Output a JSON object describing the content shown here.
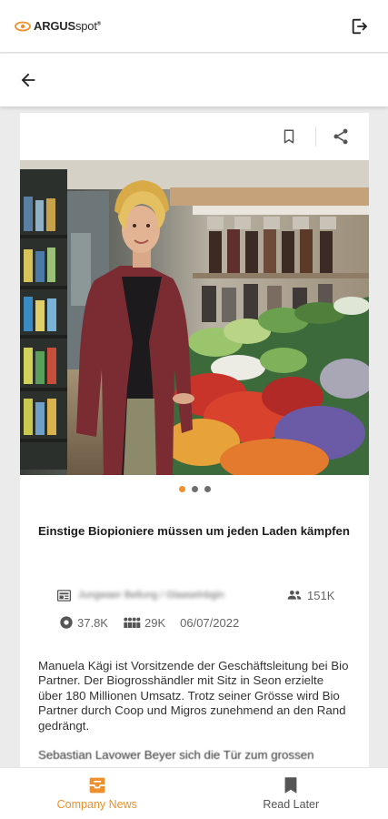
{
  "app": {
    "logo_brand": "ARGUS",
    "logo_suffix": "spot",
    "logo_mark": "®"
  },
  "icons": {
    "logout": "logout-icon",
    "back": "arrow-left-icon",
    "bookmark": "bookmark-outline-icon",
    "share": "share-icon",
    "newspaper": "newspaper-icon",
    "people": "people-icon",
    "audience": "audience-icon",
    "circle": "circle-icon",
    "company_news": "inbox-icon",
    "read_later": "bookmark-icon"
  },
  "colors": {
    "accent": "#f0902c",
    "text_dark": "#1c1c1c",
    "text_muted": "#666666"
  },
  "article": {
    "carousel": {
      "count": 3,
      "active_index": 0
    },
    "title": "Einstige Biopioniere müssen um jeden Laden kämpfen",
    "source": "Jungwaer Bellung / Glaaselnbgin",
    "reach": "151K",
    "value_stat": "37.8K",
    "audience_stat": "29K",
    "date": "06/07/2022",
    "body": "Manuela Kägi ist Vorsitzende der Geschäftsleitung bei Bio Partner. Der Biogrosshändler mit Sitz in Seon erzielte über 180 Millionen Umsatz. Trotz seiner Grösse wird Bio Partner durch Coop und Migros zunehmend an den Rand gedrängt.",
    "body_continued": "Sebastian Lavower Beyer sich die Tür zum grossen"
  },
  "bottom_nav": {
    "items": [
      {
        "label": "Company News",
        "active": true
      },
      {
        "label": "Read Later",
        "active": false
      }
    ]
  }
}
